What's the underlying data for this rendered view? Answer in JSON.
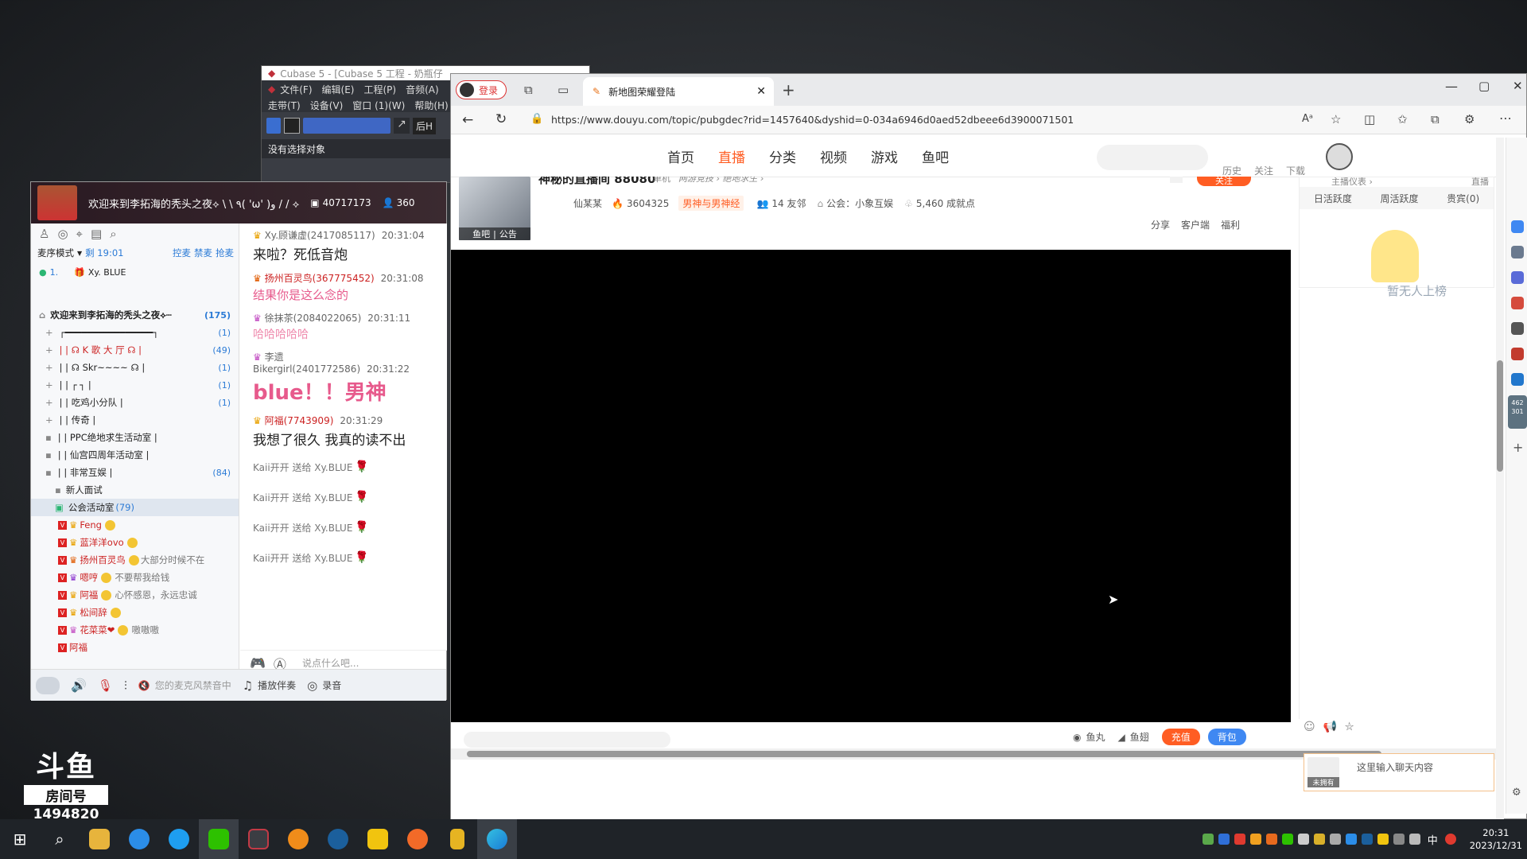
{
  "cubase": {
    "title": "Cubase 5 - [Cubase 5 工程 - 奶瓶仔",
    "menu1": [
      "文件(F)",
      "编辑(E)",
      "工程(P)",
      "音频(A)"
    ],
    "menu2": [
      "走带(T)",
      "设备(V)",
      "窗口 (1)(W)",
      "帮助(H)"
    ],
    "status": "没有选择对象",
    "btn": "后H"
  },
  "yy": {
    "header": {
      "title": "欢迎来到李拓海的秃头之夜⟡ \\ \\ ٩( 'ω' )و / / ⟡",
      "channel_id": "40717173",
      "online": "360"
    },
    "mode": {
      "label": "麦序模式",
      "time": "剩 19:01",
      "actions": [
        "控麦",
        "禁麦",
        "抢麦"
      ]
    },
    "queue": [
      {
        "rank": "1.",
        "name": "Xy. BLUE"
      }
    ],
    "tree": [
      {
        "name": "欢迎来到李拓海的秃头之夜⟡┉",
        "count": "(175)",
        "bold": true
      },
      {
        "name": "┌━━━━━━━━━━━━━━━━┐",
        "count": "(1)"
      },
      {
        "name": "| |  ☊  K  歌  大  厅  ☊       |",
        "count": "(49)"
      },
      {
        "name": "| |  ☊   Skr~~~~   ☊          |",
        "count": "(1)"
      },
      {
        "name": "| |  ┌            ┐           |",
        "count": "(1)"
      },
      {
        "name": "| |  吃鸡小分队               |",
        "count": "(1)"
      },
      {
        "name": "| |  传奇                     |",
        "count": ""
      },
      {
        "name": "| |  PPC绝地求生活动室        |",
        "count": ""
      },
      {
        "name": "| |  仙宫四周年活动室         |",
        "count": ""
      },
      {
        "name": "| |  非常互娱                 |",
        "count": "(84)"
      }
    ],
    "sub1": "新人面试",
    "active_channel": {
      "name": "公会活动室",
      "count": "(79)"
    },
    "members": [
      {
        "name": "Feng",
        "sig": ""
      },
      {
        "name": "蓝洋洋ovo",
        "sig": ""
      },
      {
        "name": "扬州百灵鸟",
        "sig": "大部分时候不在"
      },
      {
        "name": "嗯哼",
        "sig": "不要帮我给钱"
      },
      {
        "name": "阿福",
        "sig": "心怀感恩，永远忠诚"
      },
      {
        "name": "松间辞",
        "sig": ""
      },
      {
        "name": "花菜菜❤",
        "sig": "嗷嗷嗷"
      },
      {
        "name": "阿福",
        "sig": ""
      }
    ],
    "chat": [
      {
        "user": "Xy.顾谦虚(2417085117)",
        "time": "20:31:04",
        "text": "来啦？死低音炮",
        "style": "normal"
      },
      {
        "user": "扬州百灵鸟(367775452)",
        "time": "20:31:08",
        "text": "结果你是这么念的",
        "style": "pink"
      },
      {
        "user": "徐抹茶(2084022065)",
        "time": "20:31:11",
        "text": "哈哈哈哈哈",
        "style": "pinklight"
      },
      {
        "user": "李遗Bikergirl(2401772586)",
        "time": "20:31:22",
        "text": "blue！！男神",
        "style": "big"
      },
      {
        "user": "阿福(7743909)",
        "time": "20:31:29",
        "text": "我想了很久   我真的读不出",
        "style": "normal"
      }
    ],
    "gifts": [
      "Kaii开开 送给 Xy.BLUE",
      "Kaii开开 送给 Xy.BLUE",
      "Kaii开开 送给 Xy.BLUE",
      "Kaii开开 送给 Xy.BLUE"
    ],
    "input_placeholder": "说点什么吧...",
    "bottom": {
      "mic_status": "您的麦克风禁音中",
      "accomp": "播放伴奏",
      "record": "录音"
    }
  },
  "room_watermark": {
    "logo": "斗鱼",
    "label": "房间号",
    "number": "1494820"
  },
  "browser": {
    "login": "登录",
    "tab_title": "新地图荣耀登陆",
    "url": "https://www.douyu.com/topic/pubgdec?rid=1457640&dyshid=0-034a6946d0aed52dbeee6d3900071501",
    "nav": [
      "首页",
      "直播",
      "分类",
      "视频",
      "游戏",
      "鱼吧"
    ],
    "nav_active": 1,
    "user_links": [
      "历史",
      "关注",
      "下载"
    ],
    "room": {
      "title": "神秘的直播间 88080",
      "category": "单机",
      "breadcrumb": "网游竞技 ›  绝地求生 ›",
      "streamer": "仙某某",
      "heat": "3604325",
      "tag": "男神与男神经",
      "friends": "14 友邻",
      "guild": "公会：小象互娱",
      "achievements": "5,460 成就点",
      "follow": "关注",
      "avatar_tabs": [
        "鱼吧",
        "公告"
      ],
      "actions": [
        "分享",
        "客户端",
        "福利"
      ]
    },
    "rank": {
      "tabs": [
        "日活跃度",
        "周活跃度",
        "贵宾(0)"
      ],
      "top": "主播仪表 ›",
      "top2": "直播",
      "empty": "暂无人上榜"
    },
    "bottom": {
      "yuwan": "鱼丸",
      "yuchi": "鱼翅",
      "recharge": "充值",
      "bag": "背包"
    },
    "chat_input": {
      "placeholder": "这里输入聊天内容",
      "avatar_label": "未拥有"
    },
    "sidebar_counts": [
      "462",
      "301"
    ]
  },
  "taskbar": {
    "time": "20:31",
    "date": "2023/12/31",
    "ime": "中"
  },
  "colors": {
    "douyu_orange": "#ff5d23",
    "yy_pink": "#e75a8c",
    "video_bg": "#000000",
    "badge_red": "#d92020"
  }
}
